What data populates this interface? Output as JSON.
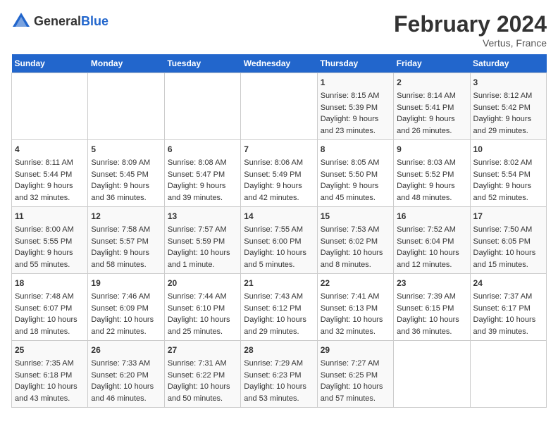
{
  "header": {
    "logo_general": "General",
    "logo_blue": "Blue",
    "month_title": "February 2024",
    "location": "Vertus, France"
  },
  "days_of_week": [
    "Sunday",
    "Monday",
    "Tuesday",
    "Wednesday",
    "Thursday",
    "Friday",
    "Saturday"
  ],
  "weeks": [
    [
      {
        "day": "",
        "content": ""
      },
      {
        "day": "",
        "content": ""
      },
      {
        "day": "",
        "content": ""
      },
      {
        "day": "",
        "content": ""
      },
      {
        "day": "1",
        "content": "Sunrise: 8:15 AM\nSunset: 5:39 PM\nDaylight: 9 hours\nand 23 minutes."
      },
      {
        "day": "2",
        "content": "Sunrise: 8:14 AM\nSunset: 5:41 PM\nDaylight: 9 hours\nand 26 minutes."
      },
      {
        "day": "3",
        "content": "Sunrise: 8:12 AM\nSunset: 5:42 PM\nDaylight: 9 hours\nand 29 minutes."
      }
    ],
    [
      {
        "day": "4",
        "content": "Sunrise: 8:11 AM\nSunset: 5:44 PM\nDaylight: 9 hours\nand 32 minutes."
      },
      {
        "day": "5",
        "content": "Sunrise: 8:09 AM\nSunset: 5:45 PM\nDaylight: 9 hours\nand 36 minutes."
      },
      {
        "day": "6",
        "content": "Sunrise: 8:08 AM\nSunset: 5:47 PM\nDaylight: 9 hours\nand 39 minutes."
      },
      {
        "day": "7",
        "content": "Sunrise: 8:06 AM\nSunset: 5:49 PM\nDaylight: 9 hours\nand 42 minutes."
      },
      {
        "day": "8",
        "content": "Sunrise: 8:05 AM\nSunset: 5:50 PM\nDaylight: 9 hours\nand 45 minutes."
      },
      {
        "day": "9",
        "content": "Sunrise: 8:03 AM\nSunset: 5:52 PM\nDaylight: 9 hours\nand 48 minutes."
      },
      {
        "day": "10",
        "content": "Sunrise: 8:02 AM\nSunset: 5:54 PM\nDaylight: 9 hours\nand 52 minutes."
      }
    ],
    [
      {
        "day": "11",
        "content": "Sunrise: 8:00 AM\nSunset: 5:55 PM\nDaylight: 9 hours\nand 55 minutes."
      },
      {
        "day": "12",
        "content": "Sunrise: 7:58 AM\nSunset: 5:57 PM\nDaylight: 9 hours\nand 58 minutes."
      },
      {
        "day": "13",
        "content": "Sunrise: 7:57 AM\nSunset: 5:59 PM\nDaylight: 10 hours\nand 1 minute."
      },
      {
        "day": "14",
        "content": "Sunrise: 7:55 AM\nSunset: 6:00 PM\nDaylight: 10 hours\nand 5 minutes."
      },
      {
        "day": "15",
        "content": "Sunrise: 7:53 AM\nSunset: 6:02 PM\nDaylight: 10 hours\nand 8 minutes."
      },
      {
        "day": "16",
        "content": "Sunrise: 7:52 AM\nSunset: 6:04 PM\nDaylight: 10 hours\nand 12 minutes."
      },
      {
        "day": "17",
        "content": "Sunrise: 7:50 AM\nSunset: 6:05 PM\nDaylight: 10 hours\nand 15 minutes."
      }
    ],
    [
      {
        "day": "18",
        "content": "Sunrise: 7:48 AM\nSunset: 6:07 PM\nDaylight: 10 hours\nand 18 minutes."
      },
      {
        "day": "19",
        "content": "Sunrise: 7:46 AM\nSunset: 6:09 PM\nDaylight: 10 hours\nand 22 minutes."
      },
      {
        "day": "20",
        "content": "Sunrise: 7:44 AM\nSunset: 6:10 PM\nDaylight: 10 hours\nand 25 minutes."
      },
      {
        "day": "21",
        "content": "Sunrise: 7:43 AM\nSunset: 6:12 PM\nDaylight: 10 hours\nand 29 minutes."
      },
      {
        "day": "22",
        "content": "Sunrise: 7:41 AM\nSunset: 6:13 PM\nDaylight: 10 hours\nand 32 minutes."
      },
      {
        "day": "23",
        "content": "Sunrise: 7:39 AM\nSunset: 6:15 PM\nDaylight: 10 hours\nand 36 minutes."
      },
      {
        "day": "24",
        "content": "Sunrise: 7:37 AM\nSunset: 6:17 PM\nDaylight: 10 hours\nand 39 minutes."
      }
    ],
    [
      {
        "day": "25",
        "content": "Sunrise: 7:35 AM\nSunset: 6:18 PM\nDaylight: 10 hours\nand 43 minutes."
      },
      {
        "day": "26",
        "content": "Sunrise: 7:33 AM\nSunset: 6:20 PM\nDaylight: 10 hours\nand 46 minutes."
      },
      {
        "day": "27",
        "content": "Sunrise: 7:31 AM\nSunset: 6:22 PM\nDaylight: 10 hours\nand 50 minutes."
      },
      {
        "day": "28",
        "content": "Sunrise: 7:29 AM\nSunset: 6:23 PM\nDaylight: 10 hours\nand 53 minutes."
      },
      {
        "day": "29",
        "content": "Sunrise: 7:27 AM\nSunset: 6:25 PM\nDaylight: 10 hours\nand 57 minutes."
      },
      {
        "day": "",
        "content": ""
      },
      {
        "day": "",
        "content": ""
      }
    ]
  ]
}
